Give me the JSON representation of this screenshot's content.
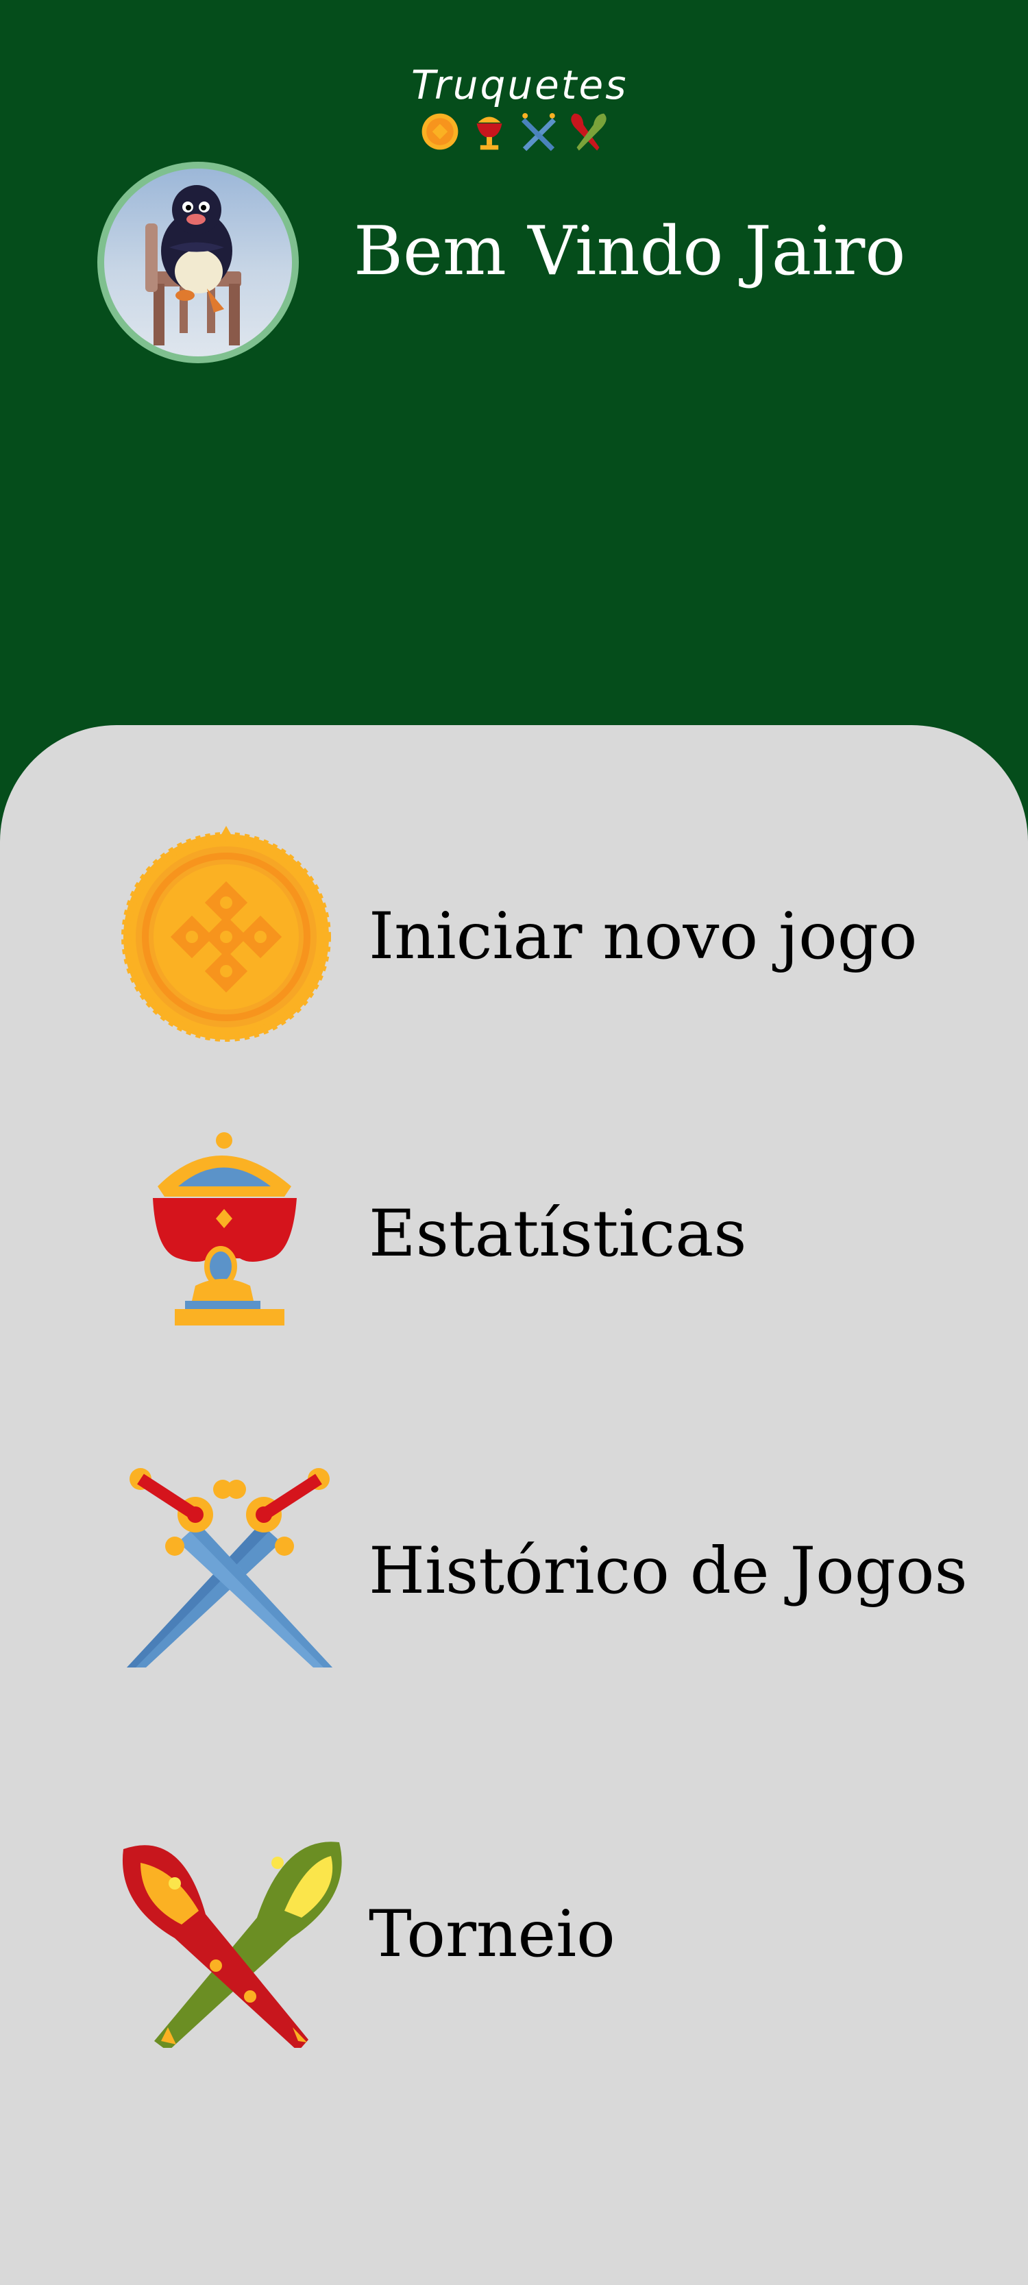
{
  "app": {
    "logo_text": "Truquetes",
    "logo_icons": [
      "coin-icon",
      "cup-icon",
      "swords-icon",
      "clubs-icon"
    ]
  },
  "user": {
    "welcome": "Bem Vindo Jairo",
    "avatar": "penguin-avatar"
  },
  "menu": {
    "items": [
      {
        "label": "Iniciar novo jogo",
        "icon": "gold-coin-icon"
      },
      {
        "label": "Estatísticas",
        "icon": "golden-cup-icon"
      },
      {
        "label": "Histórico de Jogos",
        "icon": "crossed-swords-icon"
      },
      {
        "label": "Torneio",
        "icon": "crossed-clubs-icon"
      }
    ]
  },
  "colors": {
    "header_bg": "#054d1b",
    "menu_bg": "#d9d9d9",
    "avatar_ring": "#7fc08f",
    "gold": "#fbb123",
    "red": "#c8161d",
    "blue": "#5b93c9",
    "green": "#6b8e23"
  }
}
